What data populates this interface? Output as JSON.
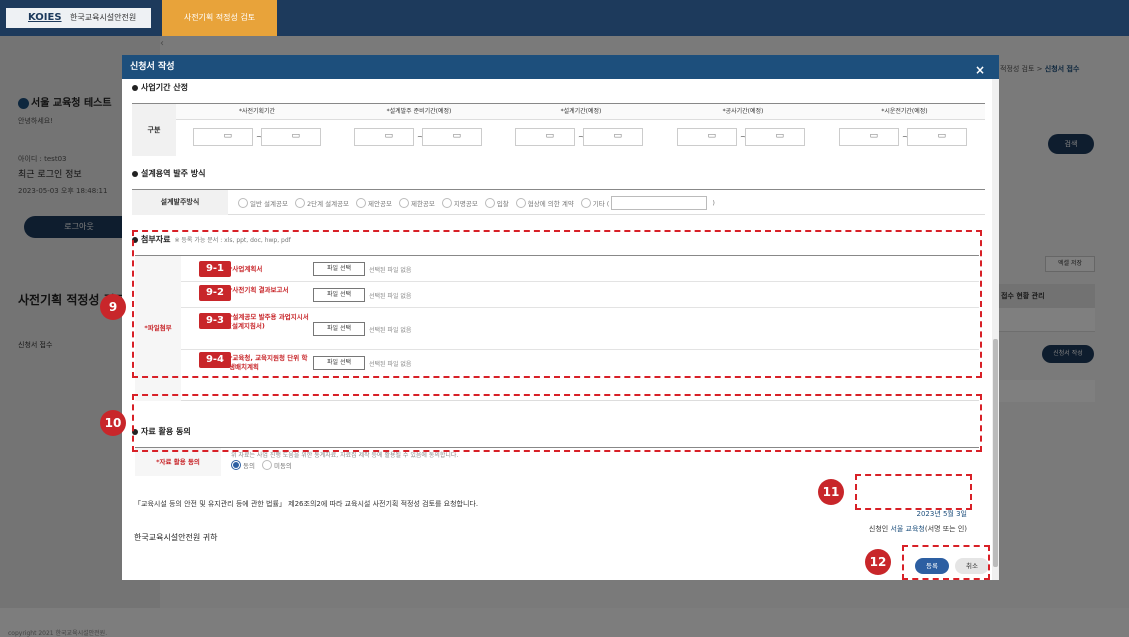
{
  "topbar": {
    "logo_abbr": "KOIES",
    "logo_text": "한국교육시설안전원",
    "active_tab": "사전기획 적정성 검토"
  },
  "sidebar": {
    "user_name": "서울 교육청 테스트",
    "greeting": "안녕하세요!",
    "user_id": "아이디 : test03",
    "last_login_title": "최근 로그인 정보",
    "last_login_date": "2023-05-03 오후 18:48:11",
    "logout_label": "로그아웃",
    "menu_title": "사전기획 적정성 검토",
    "menu_item": "신청서 접수",
    "copyright": "copyright 2021 한국교육시설안전원."
  },
  "right_panel": {
    "breadcrumb": "적정성 검토 >",
    "breadcrumb_current": "신청서 접수",
    "search_label": "검색",
    "excel_label": "엑셀 저장",
    "col_header": "접수 현황 관리",
    "write_label": "신청서 작성"
  },
  "modal": {
    "title": "신청서 작성",
    "close": "×",
    "period_section": "사업기간 산정",
    "period_row_label": "구분",
    "period_cols": [
      "*사전기획기간",
      "*설계발주 준비기간(예정)",
      "*설계기간(예정)",
      "*공사기간(예정)",
      "*시운전기간(예정)"
    ],
    "method_section": "설계용역 발주 방식",
    "method_label": "설계발주방식",
    "method_options": [
      "일반 설계공모",
      "2단계 설계공모",
      "제안공모",
      "제한공모",
      "지명공모",
      "입찰",
      "협상에 의한 계약",
      "기타 ("
    ],
    "method_close": ")",
    "attach_section": "첨부자료",
    "attach_note": "※ 등록 가능 문서 : xls, ppt, doc, hwp, pdf",
    "attach_row_label": "*파일첨부",
    "attach_items": [
      {
        "tag": "9-1",
        "label": "*사업계획서"
      },
      {
        "tag": "9-2",
        "label": "*사전기획 결과보고서"
      },
      {
        "tag": "9-3",
        "label": "*설계공모 발주용 과업지시서(설계지침서)"
      },
      {
        "tag": "9-4",
        "label": "*교육청, 교육지원청 단위 학생배치계획"
      }
    ],
    "file_btn": "파일 선택",
    "no_file": "선택된 파일 없음",
    "consent_section": "자료 활용 동의",
    "consent_label": "*자료 활용 동의",
    "consent_text": "위 자료는 사업 진행 도움을 위한 통계자료, 자료집 제작 등에 활용될 수 있음에 동의합니다.",
    "consent_yes": "동의",
    "consent_no": "미동의",
    "law_text": "「교육시설 등의 안전 및 유지관리 등에 관한 법률」 제26조의2에 따라 교육시설 사전기획 적정성 검토를 요청합니다.",
    "sign_date": "2023년 5월 3일",
    "sign_prefix": "신청인",
    "sign_name": "서울 교육청",
    "sign_suffix": "(서명 또는 인)",
    "addressee": "한국교육시설안전원 귀하",
    "register_label": "등록",
    "cancel_label": "취소"
  },
  "callouts": [
    "9",
    "10",
    "11",
    "12"
  ],
  "colors": {
    "header": "#1d4f7c",
    "accent": "#e8a33a",
    "callout": "#c8262a"
  }
}
